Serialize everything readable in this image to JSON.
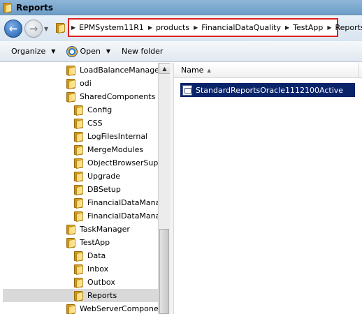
{
  "window": {
    "title": "Reports",
    "icon": "folder-icon"
  },
  "address": {
    "crumbs": [
      "EPMSystem11R1",
      "products",
      "FinancialDataQuality",
      "TestApp",
      "Reports"
    ],
    "highlight_color": "#e02020"
  },
  "toolbar": {
    "organize_label": "Organize",
    "open_label": "Open",
    "new_folder_label": "New folder"
  },
  "tree": {
    "items": [
      {
        "label": "LoadBalanceManager",
        "level": 0
      },
      {
        "label": "odi",
        "level": 0
      },
      {
        "label": "SharedComponents",
        "level": 0
      },
      {
        "label": "Config",
        "level": 1
      },
      {
        "label": "CSS",
        "level": 1
      },
      {
        "label": "LogFilesInternal",
        "level": 1
      },
      {
        "label": "MergeModules",
        "level": 1
      },
      {
        "label": "ObjectBrowserSuppo",
        "level": 1
      },
      {
        "label": "Upgrade",
        "level": 1
      },
      {
        "label": "DBSetup",
        "level": 1
      },
      {
        "label": "FinancialDataManage",
        "level": 1
      },
      {
        "label": "FinancialDataManage",
        "level": 1
      },
      {
        "label": "TaskManager",
        "level": 0
      },
      {
        "label": "TestApp",
        "level": 0
      },
      {
        "label": "Data",
        "level": 1
      },
      {
        "label": "Inbox",
        "level": 1
      },
      {
        "label": "Outbox",
        "level": 1
      },
      {
        "label": "Reports",
        "level": 1,
        "selected": true
      },
      {
        "label": "WebServerComponents",
        "level": 0
      }
    ]
  },
  "content": {
    "column_name": "Name",
    "files": [
      {
        "name": "StandardReportsOracle1112100Active"
      }
    ]
  }
}
